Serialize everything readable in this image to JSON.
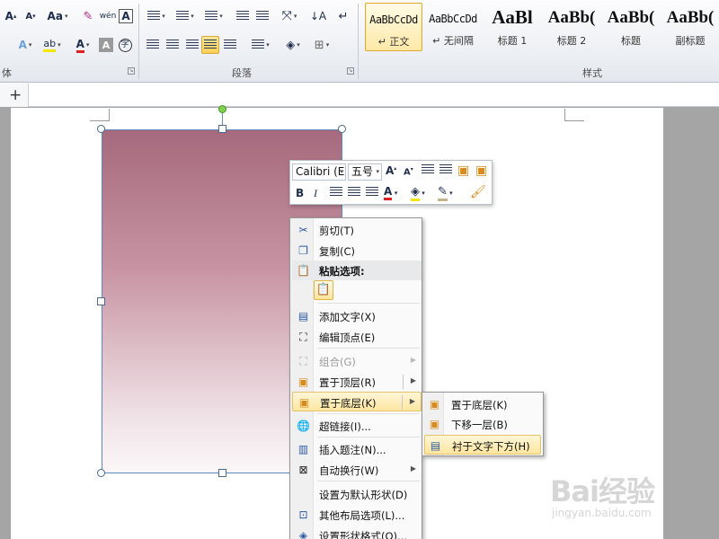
{
  "ribbon": {
    "groups": {
      "font_label": "体",
      "paragraph_label": "段落",
      "styles_label": "样式"
    },
    "font_buttons": {
      "grow": "A",
      "shrink": "A",
      "change_case": "Aa",
      "phonetic": "wén",
      "char_border": "A",
      "text_effect": "A",
      "highlight": "ab",
      "font_color": "A",
      "char_shading": "A",
      "enclose": "字"
    },
    "styles": [
      {
        "sample": "AaBbCcDd",
        "name": "↵ 正文",
        "selected": true
      },
      {
        "sample": "AaBbCcDd",
        "name": "↵ 无间隔",
        "selected": false
      },
      {
        "sample": "AaBl",
        "name": "标题 1",
        "selected": false
      },
      {
        "sample": "AaBb(",
        "name": "标题 2",
        "selected": false
      },
      {
        "sample": "AaBb(",
        "name": "标题",
        "selected": false
      },
      {
        "sample": "AaBb(",
        "name": "副标题",
        "selected": false
      }
    ]
  },
  "tabbar": {
    "add_label": "+"
  },
  "mini_toolbar": {
    "font_name": "Calibri (E",
    "font_size": "五号",
    "bold": "B",
    "italic": "I",
    "font_color": "A"
  },
  "context_menu": {
    "items": [
      {
        "label": "剪切(T)",
        "icon": "scissors-icon"
      },
      {
        "label": "复制(C)",
        "icon": "copy-icon"
      },
      {
        "label": "粘贴选项:",
        "icon": "paste-icon"
      },
      {
        "label": "添加文字(X)",
        "icon": "add-text-icon"
      },
      {
        "label": "编辑顶点(E)",
        "icon": "edit-points-icon"
      },
      {
        "label": "组合(G)",
        "icon": "group-icon",
        "disabled": true
      },
      {
        "label": "置于顶层(R)",
        "icon": "bring-front-icon"
      },
      {
        "label": "置于底层(K)",
        "icon": "send-back-icon"
      },
      {
        "label": "超链接(I)...",
        "icon": "hyperlink-icon"
      },
      {
        "label": "插入题注(N)...",
        "icon": "caption-icon"
      },
      {
        "label": "自动换行(W)",
        "icon": "wrap-icon"
      },
      {
        "label": "设置为默认形状(D)",
        "icon": ""
      },
      {
        "label": "其他布局选项(L)...",
        "icon": "layout-icon"
      },
      {
        "label": "设置形状格式(O)...",
        "icon": "format-shape-icon"
      }
    ]
  },
  "submenu": {
    "items": [
      {
        "label": "置于底层(K)",
        "icon": "send-to-back-icon"
      },
      {
        "label": "下移一层(B)",
        "icon": "send-backward-icon"
      },
      {
        "label": "衬于文字下方(H)",
        "icon": "behind-text-icon"
      }
    ]
  },
  "watermark": {
    "logo": "Bai经验",
    "sub": "jingyan.baidu.com"
  },
  "colors": {
    "shape_top": "#a56a7d",
    "shape_bottom": "#fbf7f8",
    "highlight": "#ffe6a0",
    "accent_border": "#e3a829"
  }
}
